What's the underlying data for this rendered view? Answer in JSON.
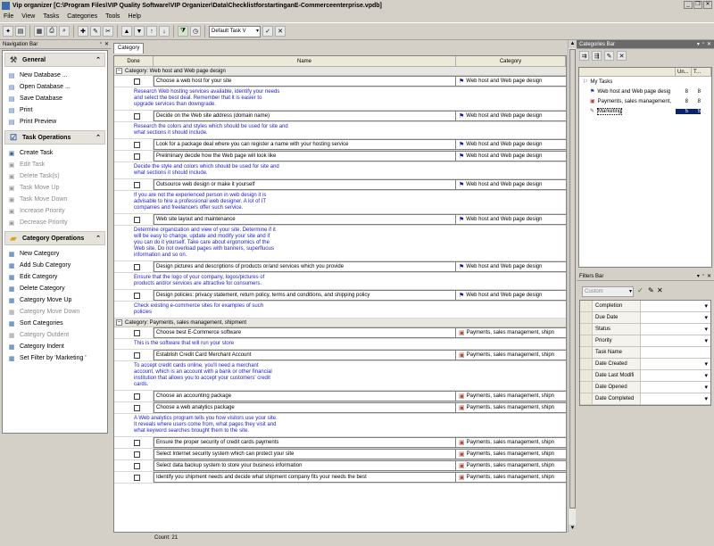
{
  "app": {
    "title": "Vip organizer [C:\\Program Files\\VIP Quality Software\\VIP Organizer\\Data\\ChecklistforstartinganE-Commerceenterprise.vpdb]"
  },
  "menu": [
    "File",
    "View",
    "Tasks",
    "Categories",
    "Tools",
    "Help"
  ],
  "toolbar": {
    "task_view": "Default Task V"
  },
  "nav": {
    "title": "Navigation Bar",
    "groups": [
      {
        "title": "General",
        "items": [
          {
            "label": "New Database ...",
            "enabled": true
          },
          {
            "label": "Open Database ...",
            "enabled": true
          },
          {
            "label": "Save Database",
            "enabled": true
          },
          {
            "label": "Print",
            "enabled": true
          },
          {
            "label": "Print Preview",
            "enabled": true
          }
        ]
      },
      {
        "title": "Task Operations",
        "items": [
          {
            "label": "Create Task",
            "enabled": true
          },
          {
            "label": "Edit Task",
            "enabled": false
          },
          {
            "label": "Delete Task(s)",
            "enabled": false
          },
          {
            "label": "Task Move Up",
            "enabled": false
          },
          {
            "label": "Task Move Down",
            "enabled": false
          },
          {
            "label": "Increase Priority",
            "enabled": false
          },
          {
            "label": "Decrease Priority",
            "enabled": false
          }
        ]
      },
      {
        "title": "Category Operations",
        "items": [
          {
            "label": "New Category",
            "enabled": true
          },
          {
            "label": "Add Sub Category",
            "enabled": true
          },
          {
            "label": "Edit Category",
            "enabled": true
          },
          {
            "label": "Delete Category",
            "enabled": true
          },
          {
            "label": "Category Move Up",
            "enabled": true
          },
          {
            "label": "Category Move Down",
            "enabled": false
          },
          {
            "label": "Sort Categories",
            "enabled": true
          },
          {
            "label": "Category Outdent",
            "enabled": false
          },
          {
            "label": "Category Indent",
            "enabled": true
          },
          {
            "label": "Set Filter by 'Marketing '",
            "enabled": true
          }
        ]
      }
    ]
  },
  "grid": {
    "tab": "Category",
    "columns": {
      "done": "Done",
      "name": "Name",
      "category": "Category"
    },
    "groups": [
      {
        "header": "Category: Web host and Web page design",
        "rows": [
          {
            "name": "Choose a web host for your site",
            "category": "Web host and Web page design",
            "note": "Research Web hosting services available, identify your needs\nand select the best deal. Remember that it is easier to\nupgrade services than downgrade."
          },
          {
            "name": "Decide on the Web site address (domain name)",
            "category": "Web host and Web page design",
            "note": "Research the colors and styles which should be used for site and\nwhat sections it should include."
          },
          {
            "name": "Look for a package deal where you can register a name with your hosting service",
            "category": "Web host and Web page design",
            "note": ""
          },
          {
            "name": "Preliminary decide how the Web page will look like",
            "category": "Web host and Web page design",
            "note": "Decide the style and colors which should be used for site and\nwhat sections it should include."
          },
          {
            "name": "Outsource web design or make it yourself",
            "category": "Web host and Web page design",
            "note": "If you are not the experienced person in web design it is\nadvisable to hire a professional web designer. A lot of IT\ncompanies and freelancers offer such service."
          },
          {
            "name": "Web site layout and maintenance",
            "category": "Web host and Web page design",
            "note": "Determine organization and view of your site. Determine if it\nwill be easy to change, update and modify your site and if\nyou can do it yourself. Take care about ergonomics of the\nWeb site. Do not overload pages with banners, superfluous\ninformation and so on."
          },
          {
            "name": "Design pictures and descriptions of products or/and services which you provide",
            "category": "Web host and Web page design",
            "note": "Ensure that the logo of your company, logos/pictures of\nproducts and/or services are attractive for consumers."
          },
          {
            "name": "Design policies: privacy statement, return policy, terms and conditions, and shipping policy",
            "category": "Web host and Web page design",
            "note": "Check existing e-commerce sites for examples of such\npolicies"
          }
        ]
      },
      {
        "header": "Category: Payments, sales management, shipment",
        "rows": [
          {
            "name": "Choose best E-Commerce software",
            "category": "Payments, sales management, shipn",
            "note": "This is the software that will run your store"
          },
          {
            "name": "Establish Credit Card Merchant Account",
            "category": "Payments, sales management, shipn",
            "note": "To accept credit cards online, you'll need a merchant\naccount, which is an account with a bank or other financial\ninstitution that allows you to accept your customers' credit\ncards."
          },
          {
            "name": "Choose an accounting package",
            "category": "Payments, sales management, shipn",
            "note": ""
          },
          {
            "name": "Choose a web analytics package",
            "category": "Payments, sales management, shipn",
            "note": "A Web analytics program tells you how visitors use your site.\nIt reveals where users come from, what pages they visit and\nwhat keyword searches brought them to the site."
          },
          {
            "name": "Ensure the proper security of credit cards payments",
            "category": "Payments, sales management, shipn",
            "note": ""
          },
          {
            "name": "Select Internet security system which can protect your site",
            "category": "Payments, sales management, shipn",
            "note": ""
          },
          {
            "name": "Select data backup system to store your business information",
            "category": "Payments, sales management, shipn",
            "note": ""
          },
          {
            "name": "Identify you shipment needs and decide what shipment company fits your needs the best",
            "category": "Payments, sales management, shipn",
            "note": ""
          }
        ]
      }
    ],
    "status": "Count: 21"
  },
  "categories": {
    "title": "Categories Bar",
    "columns": {
      "u": "Un...",
      "t": "T..."
    },
    "items": [
      {
        "label": "My Tasks",
        "u": "",
        "t": "",
        "indent": 0,
        "selected": false
      },
      {
        "label": "Web host and Web page desig",
        "u": "8",
        "t": "8",
        "indent": 1,
        "selected": false
      },
      {
        "label": "Payments, sales management,",
        "u": "8",
        "t": "8",
        "indent": 1,
        "selected": false
      },
      {
        "label": "Marketing",
        "u": "5",
        "t": "5",
        "indent": 1,
        "selected": true
      }
    ]
  },
  "filters": {
    "title": "Filters Bar",
    "select": "Custom",
    "rows": [
      "Completion",
      "Due Date",
      "Status",
      "Priority",
      "Task Name",
      "Date Created",
      "Date Last Modifi",
      "Date Opened",
      "Date Completed"
    ]
  }
}
